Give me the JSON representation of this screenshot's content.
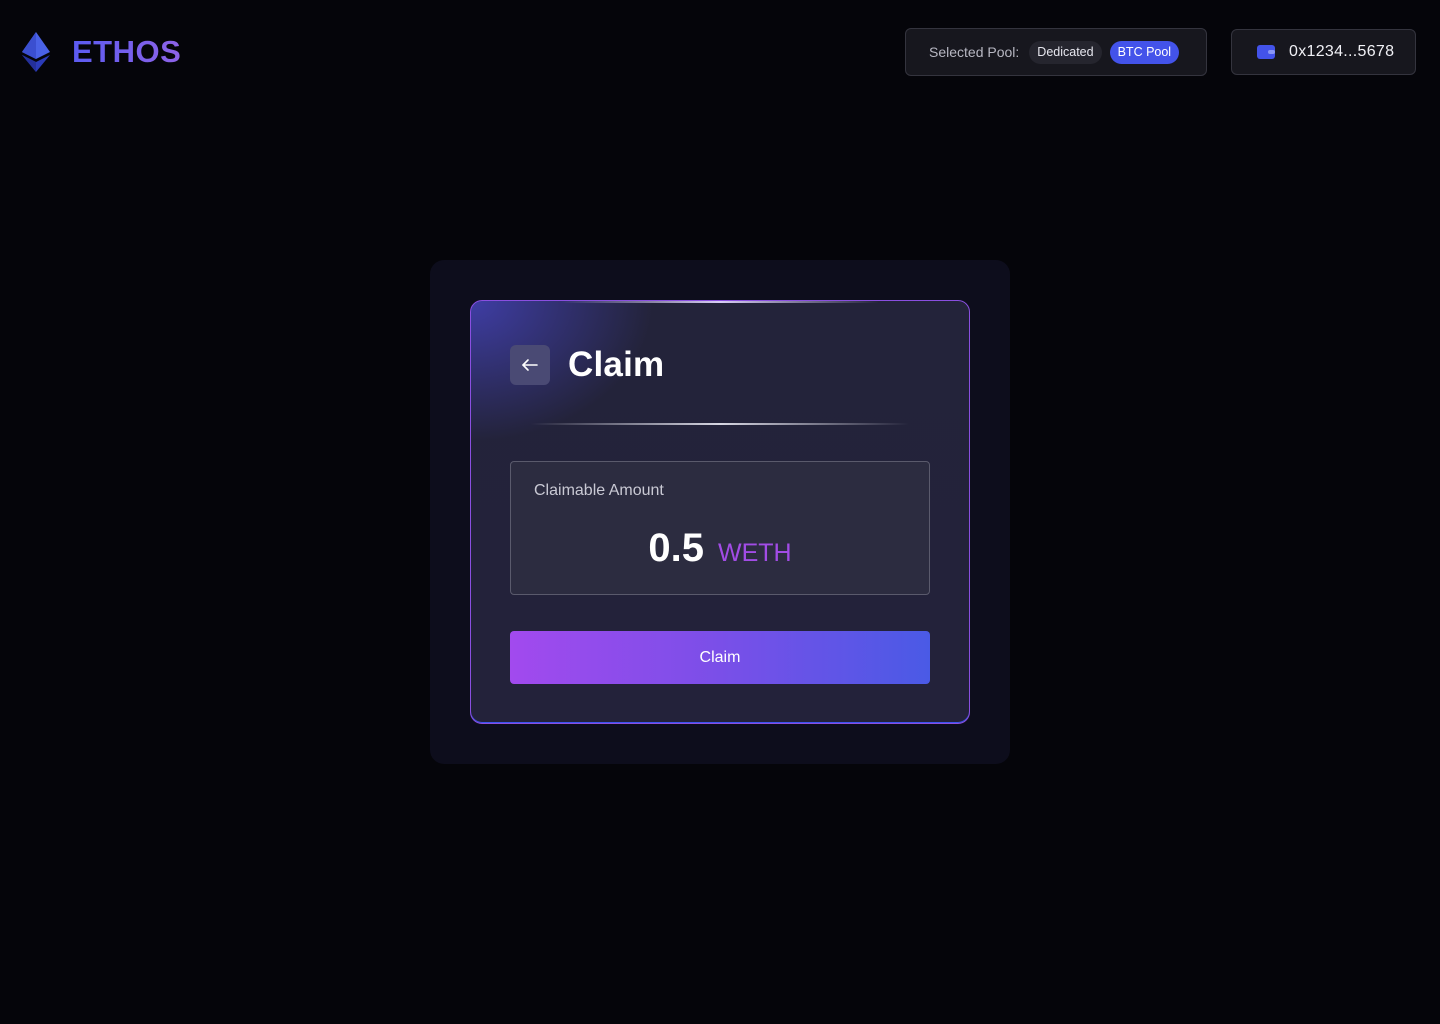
{
  "brand": {
    "name": "ETHOS",
    "logo_icon": "ethereum-diamond-icon"
  },
  "pool": {
    "label": "Selected Pool:",
    "options": [
      "Dedicated",
      "BTC Pool"
    ],
    "selected": "BTC Pool"
  },
  "wallet": {
    "icon": "wallet-icon",
    "address": "0x1234...5678"
  },
  "card": {
    "back_icon": "arrow-left-icon",
    "title": "Claim",
    "claimable_label": "Claimable Amount",
    "amount": "0.5",
    "token": "WETH",
    "claim_button": "Claim"
  },
  "colors": {
    "background": "#05050a",
    "brand": "#6c5ce7",
    "chip_active": "#4353ea",
    "token": "#a24ce6",
    "button_start": "#a24aee",
    "button_end": "#4a5ae6"
  }
}
